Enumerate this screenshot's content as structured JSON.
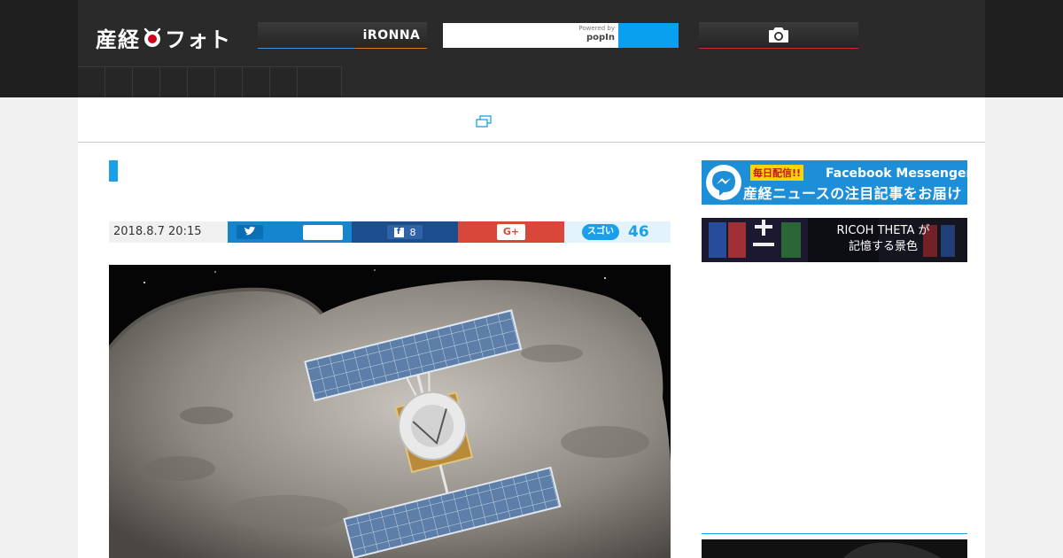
{
  "header": {
    "logo_text_left": "産経",
    "logo_text_right": "フォト",
    "ironna_label": "iRONNA",
    "search": {
      "powered_by": "Powered by",
      "provider": "popIn"
    },
    "camera_icon": "camera-icon",
    "nav_items_count": 9
  },
  "article": {
    "date": "2018.8.7 20:15",
    "share": {
      "twitter_icon": "twitter-icon",
      "facebook_count": "8",
      "google_plus_label": "G+",
      "sugoi_label": "スゴいっ!",
      "sugoi_count": "46"
    }
  },
  "sidebar": {
    "ad_messenger": {
      "tag": "毎日配信!!",
      "line1": "Facebook Messenger で",
      "line2": "産経ニュースの注目記事をお届け"
    },
    "ad_ricoh": {
      "line1": "RICOH THETA が",
      "line2": "記憶する景色"
    }
  },
  "colors": {
    "accent": "#1aa0e8",
    "twitter": "#1585cf",
    "facebook": "#1b4d8f",
    "google_plus": "#d9473a",
    "header_bg": "#2a2a2a"
  }
}
